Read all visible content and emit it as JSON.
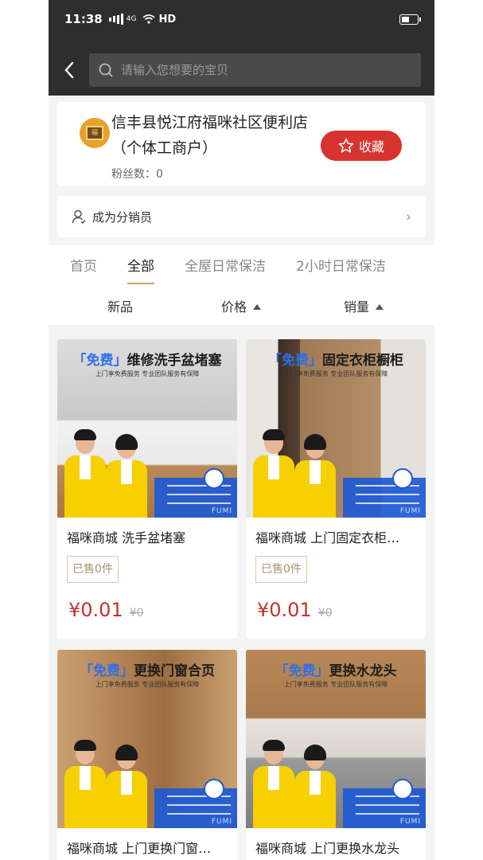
{
  "status_bar": {
    "time": "11:38",
    "network": "4G",
    "hd": "HD"
  },
  "search": {
    "placeholder": "请输入您想要的宝贝"
  },
  "shop": {
    "name": "信丰县悦江府福咪社区便利店（个体工商户）",
    "fans_label": "粉丝数：",
    "fans_count": "0",
    "favorite_label": "收藏"
  },
  "distributor": {
    "label": "成为分销员"
  },
  "tabs": [
    {
      "label": "首页",
      "active": false
    },
    {
      "label": "全部",
      "active": true
    },
    {
      "label": "全屋日常保洁",
      "active": false
    },
    {
      "label": "2小时日常保洁",
      "active": false
    }
  ],
  "sort": {
    "new": "新品",
    "price": "价格",
    "sales": "销量"
  },
  "products": [
    {
      "banner_free": "「免费」",
      "banner_rest": "维修洗手盆堵塞",
      "banner_sub": "上门享免费服务 专业团队服务有保障",
      "title": "福咪商城 洗手盆堵塞",
      "sold": "已售0件",
      "price": "¥0.01",
      "orig_price": "¥0",
      "scene": "sink"
    },
    {
      "banner_free": "「免费」",
      "banner_rest": "固定衣柜橱柜",
      "banner_sub": "上门享免费服务 专业团队服务有保障",
      "title": "福咪商城 上门固定衣柜…",
      "sold": "已售0件",
      "price": "¥0.01",
      "orig_price": "¥0",
      "scene": "wardrobe"
    },
    {
      "banner_free": "「免费」",
      "banner_rest": "更换门窗合页",
      "banner_sub": "上门享免费服务 专业团队服务有保障",
      "title": "福咪商城 上门更换门窗…",
      "sold": "",
      "price": "",
      "orig_price": "",
      "scene": "hinge"
    },
    {
      "banner_free": "「免费」",
      "banner_rest": "更换水龙头",
      "banner_sub": "上门享免费服务 专业团队服务有保障",
      "title": "福咪商城 上门更换水龙头",
      "sold": "",
      "price": "",
      "orig_price": "",
      "scene": "faucet"
    }
  ],
  "brand_mark": "FUMI",
  "colors": {
    "header_bg": "#2e2e2e",
    "accent_red": "#d8342f",
    "tab_underline": "#c9a268",
    "price": "#c0332e",
    "banner_blue": "#2e6fe8",
    "vest_yellow": "#f6d000"
  }
}
